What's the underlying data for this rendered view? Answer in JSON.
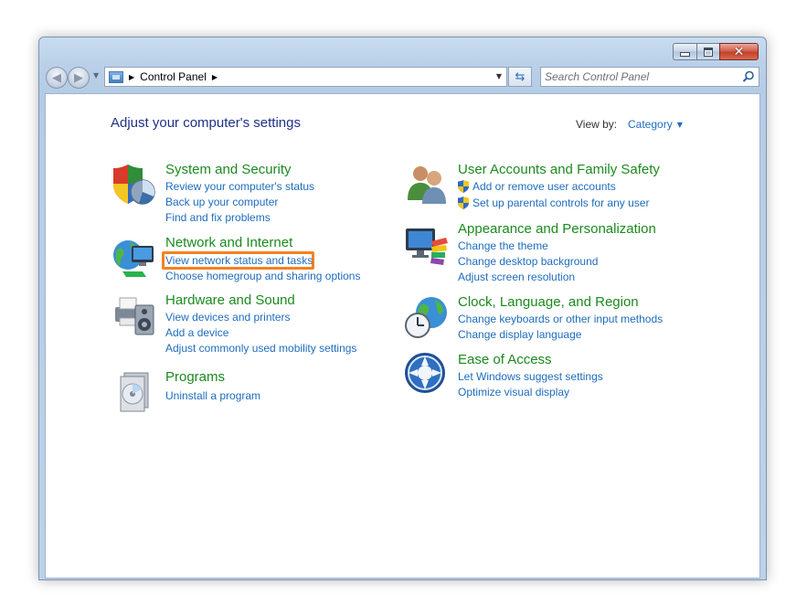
{
  "window": {
    "caption_buttons": {
      "minimize_icon": "minimize-icon",
      "maximize_icon": "maximize-icon",
      "close_glyph": "✕"
    }
  },
  "nav": {
    "back_icon": "back-arrow-icon",
    "forward_icon": "forward-arrow-icon",
    "breadcrumb": [
      "Control Panel"
    ],
    "search_placeholder": "Search Control Panel"
  },
  "main": {
    "title": "Adjust your computer's settings",
    "view_by_label": "View by:",
    "view_by_value": "Category",
    "categories_left": [
      {
        "title": "System and Security",
        "icon": "shield-icon",
        "links": [
          "Review your computer's status",
          "Back up your computer",
          "Find and fix problems"
        ]
      },
      {
        "title": "Network and Internet",
        "icon": "network-globe-icon",
        "links": [
          "View network status and tasks",
          "Choose homegroup and sharing options"
        ],
        "highlighted_link": "View network status and tasks"
      },
      {
        "title": "Hardware and Sound",
        "icon": "printer-speaker-icon",
        "links": [
          "View devices and printers",
          "Add a device",
          "Adjust commonly used mobility settings"
        ]
      },
      {
        "title": "Programs",
        "icon": "programs-disc-icon",
        "links": [
          "Uninstall a program"
        ]
      }
    ],
    "categories_right": [
      {
        "title": "User Accounts and Family Safety",
        "icon": "users-icon",
        "links": [
          "Add or remove user accounts",
          "Set up parental controls for any user"
        ]
      },
      {
        "title": "Appearance and Personalization",
        "icon": "monitor-palette-icon",
        "links": [
          "Change the theme",
          "Change desktop background",
          "Adjust screen resolution"
        ]
      },
      {
        "title": "Clock, Language, and Region",
        "icon": "clock-globe-icon",
        "links": [
          "Change keyboards or other input methods",
          "Change display language"
        ]
      },
      {
        "title": "Ease of Access",
        "icon": "ease-of-access-icon",
        "links": [
          "Let Windows suggest settings",
          "Optimize visual display"
        ]
      }
    ]
  },
  "colors": {
    "category_title": "#1b8a1e",
    "link": "#1e6cbd",
    "page_title": "#1e3287",
    "highlight_border": "#f4811f"
  }
}
